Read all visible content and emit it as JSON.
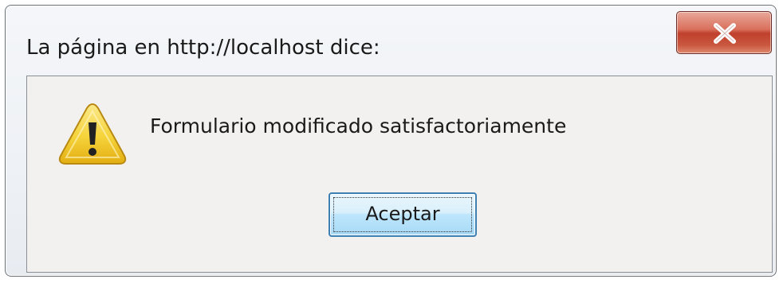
{
  "dialog": {
    "title": "La página en http://localhost dice:",
    "message": "Formulario modificado satisfactoriamente",
    "ok_label": "Aceptar",
    "close_icon": "close-icon",
    "message_icon": "warning-icon"
  },
  "colors": {
    "close_button": "#c7503a",
    "ok_button_border": "#3c7fb1",
    "warning_fill": "#f5d33a"
  }
}
